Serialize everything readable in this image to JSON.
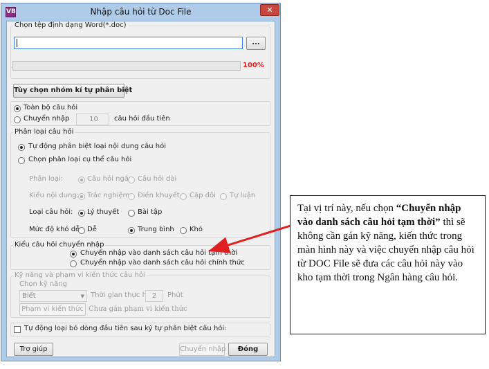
{
  "window": {
    "title": "Nhập câu hỏi từ Doc File",
    "app_icon": "VB",
    "close": "✕"
  },
  "file_section": {
    "label": "Chọn tệp định dạng Word(*.doc)",
    "file_value": "",
    "browse_label": "...",
    "progress_percent": 100,
    "progress_text": "100%"
  },
  "delimiter_button": "Tùy chọn nhóm kí tự phân biệt",
  "scope": {
    "all_label": "Toàn bộ câu hỏi",
    "partial_label": "Chuyển nhập",
    "count_value": "10",
    "count_suffix": "câu hỏi đầu tiên",
    "selected": "all"
  },
  "classify": {
    "title": "Phân loại câu hỏi",
    "auto_label": "Tự động phân biệt loại nội dung câu hỏi",
    "manual_label": "Chọn phân loại cụ thể câu hỏi",
    "selected": "auto",
    "category_label": "Phân loại:",
    "short_label": "Câu hỏi ngắn",
    "long_label": "Câu hỏi dài",
    "content_type_label": "Kiểu nội dung:",
    "multiple_choice": "Trắc nghiệm",
    "fill_blank": "Điền khuyết",
    "matching": "Cặp đôi",
    "essay": "Tự luận",
    "question_type_label": "Loại câu hỏi:",
    "theory": "Lý thuyết",
    "exercise": "Bài tập",
    "difficulty_label": "Mức độ khó dễ:",
    "easy": "Dễ",
    "medium": "Trung bình",
    "hard": "Khó"
  },
  "import_type": {
    "title": "Kiểu câu hỏi chuyển nhập",
    "temp_label": "Chuyển nhập vào danh sách câu hỏi tạm thời",
    "official_label": "Chuyển nhập vào danh sách câu hỏi chính thức",
    "selected": "temp"
  },
  "skills": {
    "title": "Kỹ năng và phạm vi kiến thức câu hỏi",
    "skill_label": "Chọn kỹ năng",
    "skill_value": "Biết",
    "time_label": "Thời gian thực hiện:",
    "time_value": "2",
    "time_unit": "Phút",
    "scope_button": "Phạm vi kiến thức",
    "scope_note": "Chưa gán phạm vi kiến thức"
  },
  "auto_remove_label": "Tự động loại bỏ dòng đầu tiên sau ký tự phân biệt câu hỏi:",
  "buttons": {
    "help": "Trợ giúp",
    "import": "Chuyển nhập",
    "close": "Đóng"
  },
  "note": {
    "part1": "Tại vị trí này, nếu chọn ",
    "bold": "“Chuyển nhập vào danh sách câu hỏi tạm thời”",
    "part2": " thì sẽ không cần gán kỹ năng, kiến thức trong màn hình này và việc chuyển nhập câu hỏi từ DOC File sẽ đưa các câu hỏi này vào kho tạm thời trong Ngân hàng câu hỏi."
  },
  "colors": {
    "accent_red": "#e02020",
    "titlebar": "#aecbea",
    "client_bg": "#f0f0f0"
  },
  "icons": {
    "app": "app-icon",
    "close": "close-icon",
    "dropdown": "chevron-down-icon"
  }
}
